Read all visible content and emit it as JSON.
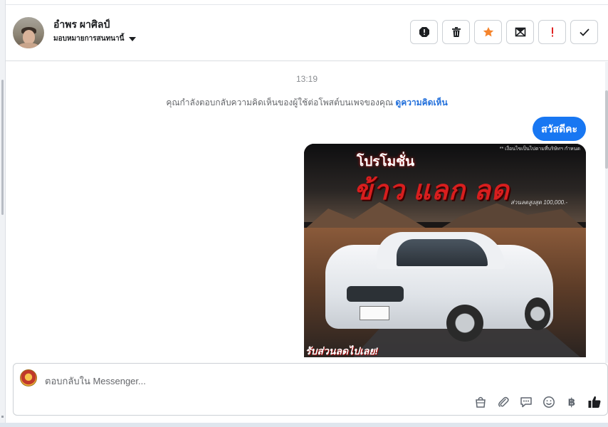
{
  "header": {
    "contact_name": "อำพร ผาศิลป์",
    "assign_label": "มอบหมายการสนทนานี้",
    "actions": [
      {
        "name": "spam-icon",
        "label": "!"
      },
      {
        "name": "trash-icon",
        "label": ""
      },
      {
        "name": "star-icon",
        "label": ""
      },
      {
        "name": "mark-unread-icon",
        "label": ""
      },
      {
        "name": "important-icon",
        "label": "!"
      },
      {
        "name": "done-icon",
        "label": ""
      }
    ],
    "colors": {
      "star": "#f5842c",
      "important": "#e02020"
    }
  },
  "conversation": {
    "timestamp": "13:19",
    "notice_text": "คุณกำลังตอบกลับความคิดเห็นของผู้ใช้ต่อโพสต์บนเพจของคุณ",
    "notice_link": "ดูความคิดเห็น",
    "outgoing_message": "สวัสดีคะ",
    "promo_image": {
      "title_line1": "โปรโมชั่น",
      "title_line2": "ข้าว แลก ลด",
      "note_top": "** เงื่อนไขเป็นไปตามที่บริษัทฯ กำหนด",
      "discount_text": "ส่วนลดสูงสุด 100,000.-",
      "bottom_text": "รับส่วนลดไปเลย!"
    }
  },
  "composer": {
    "placeholder": "ตอบกลับใน Messenger...",
    "baht_symbol": "฿",
    "tools": [
      "bag-icon",
      "attach-icon",
      "saved-reply-icon",
      "emoji-icon",
      "baht-icon",
      "like-icon"
    ]
  }
}
